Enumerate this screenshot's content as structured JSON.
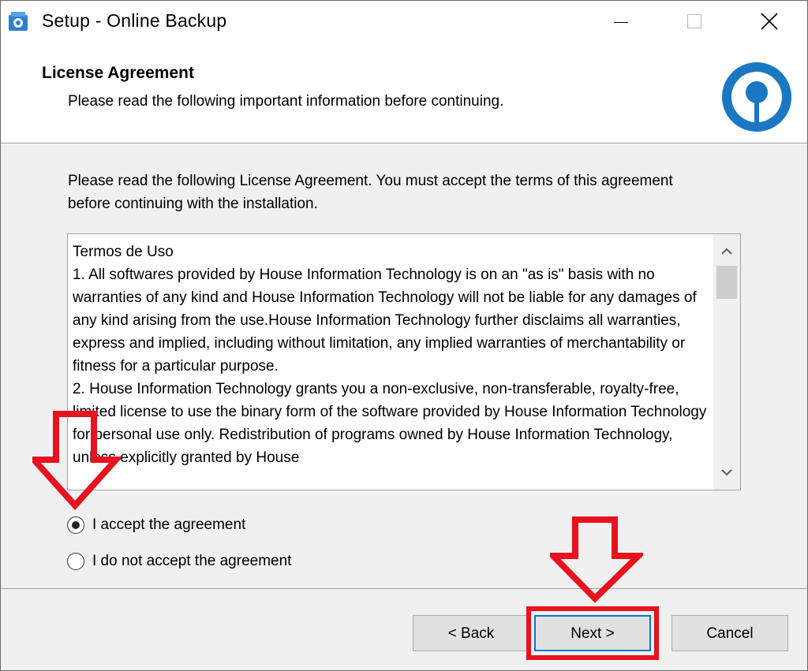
{
  "window": {
    "title": "Setup - Online Backup"
  },
  "header": {
    "title": "License Agreement",
    "subtitle": "Please read the following important information before continuing."
  },
  "body": {
    "intro": "Please read the following License Agreement. You must accept the terms of this agreement before continuing with the installation.",
    "license_text": "Termos de Uso\n1. All softwares provided by House Information Technology is on an \"as is\" basis with no warranties of any kind and House Information Technology will not be liable for any damages of any kind arising from the use.House Information Technology further disclaims all warranties, express and implied, including without limitation, any implied warranties of merchantability or fitness for a particular purpose.\n2. House Information Technology grants you a non-exclusive, non-transferable, royalty-free, limited license to use the binary form of the software provided by House Information Technology for personal use only. Redistribution of programs owned by House Information Technology, unless explicitly granted by House",
    "radio_accept": "I accept the agreement",
    "radio_decline": "I do not accept the agreement",
    "selected": "accept"
  },
  "buttons": {
    "back": "< Back",
    "next": "Next >",
    "cancel": "Cancel"
  },
  "annotations": {
    "color": "#e8111e"
  },
  "icons": {
    "app": "setup-app-icon",
    "logo": "online-backup-logo",
    "minimize": "minimize-icon",
    "maximize": "maximize-icon",
    "close": "close-icon",
    "scroll_up": "chevron-up-icon",
    "scroll_down": "chevron-down-icon"
  }
}
